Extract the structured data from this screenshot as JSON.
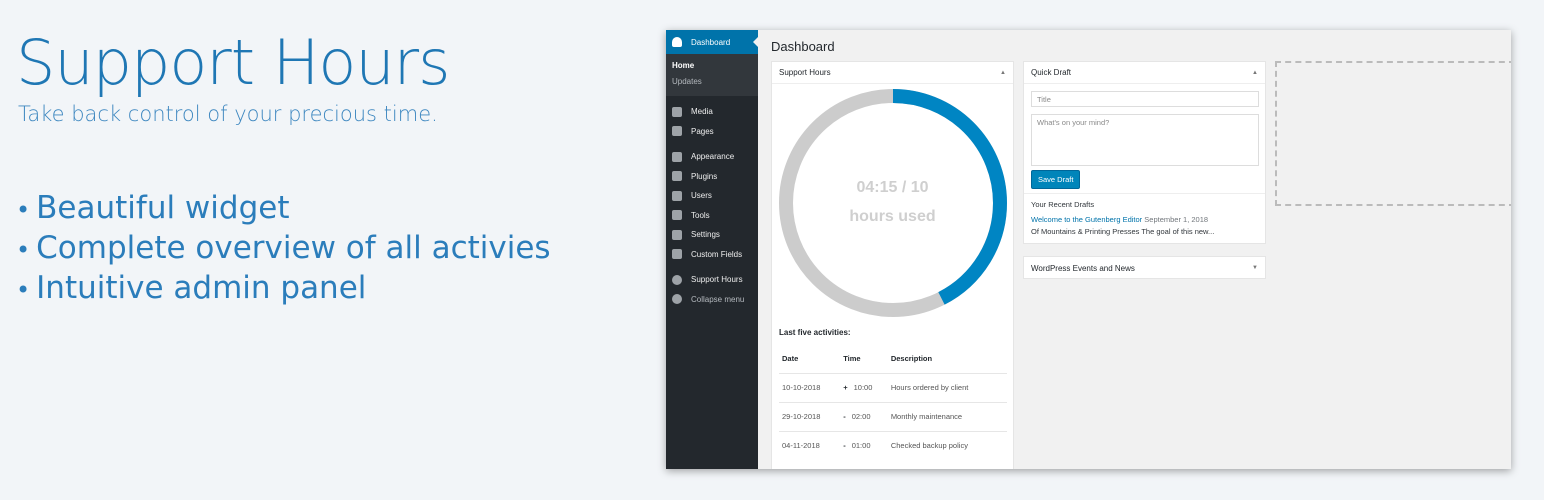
{
  "hero": {
    "title": "Support Hours",
    "subtitle": "Take back control of your precious time.",
    "bullets": [
      "Beautiful widget",
      "Complete overview of all activies",
      "Intuitive admin panel"
    ]
  },
  "sidebar": {
    "active": "Dashboard",
    "sub": [
      "Home",
      "Updates"
    ],
    "items": [
      {
        "label": "Media",
        "icon": "media-icon"
      },
      {
        "label": "Pages",
        "icon": "pages-icon"
      },
      {
        "label": "Appearance",
        "icon": "appearance-icon"
      },
      {
        "label": "Plugins",
        "icon": "plugins-icon"
      },
      {
        "label": "Users",
        "icon": "users-icon"
      },
      {
        "label": "Tools",
        "icon": "tools-icon"
      },
      {
        "label": "Settings",
        "icon": "settings-icon"
      },
      {
        "label": "Custom Fields",
        "icon": "custom-fields-icon"
      },
      {
        "label": "Support Hours",
        "icon": "clock-icon"
      },
      {
        "label": "Collapse menu",
        "icon": "collapse-icon"
      }
    ]
  },
  "main": {
    "title": "Dashboard"
  },
  "support": {
    "title": "Support Hours",
    "used_text": "04:15 / 10",
    "used_label": "hours used",
    "progress_fraction": 0.425,
    "colors": {
      "fill": "#0085c3",
      "track": "#cccccc"
    },
    "activities_title": "Last five activities:",
    "headers": [
      "Date",
      "Time",
      "Description"
    ],
    "rows": [
      [
        "10-10-2018",
        "+",
        "10:00",
        "Hours ordered by client"
      ],
      [
        "29-10-2018",
        "-",
        "02:00",
        "Monthly maintenance"
      ],
      [
        "04-11-2018",
        "-",
        "01:00",
        "Checked backup policy"
      ]
    ]
  },
  "quick_draft": {
    "title": "Quick Draft",
    "title_placeholder": "Title",
    "body_placeholder": "What's on your mind?",
    "save": "Save Draft",
    "recent": "Your Recent Drafts",
    "draft1_link": "Welcome to the Gutenberg Editor",
    "draft1_date": "September 1, 2018",
    "draft2": "Of Mountains & Printing Presses The goal of this new..."
  },
  "events": {
    "title": "WordPress Events and News"
  }
}
